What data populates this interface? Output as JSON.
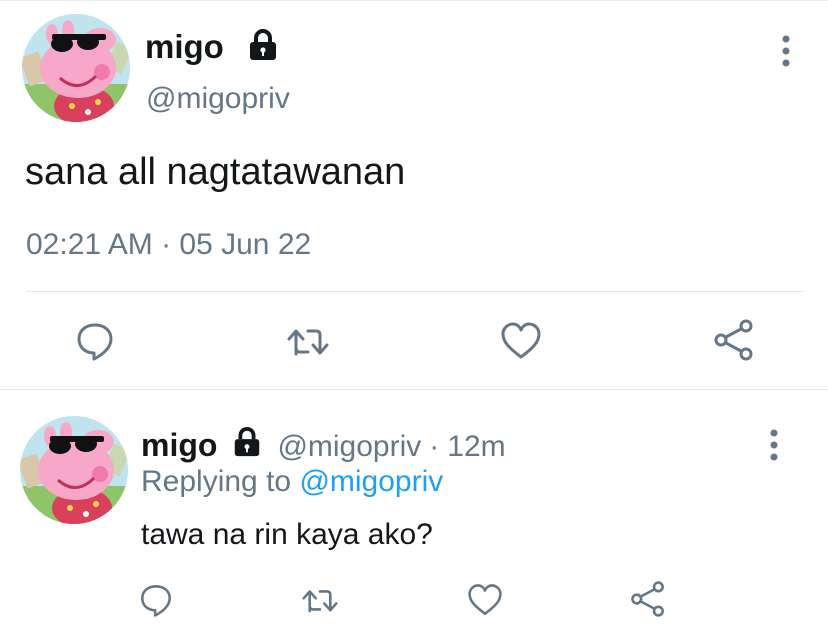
{
  "main_tweet": {
    "author_name": "migo",
    "author_handle": "@migopriv",
    "text": "sana all nagtatawanan",
    "timestamp": "02:21 AM · 05 Jun 22",
    "icons": {
      "lock": "lock-icon",
      "more": "more-vertical-icon",
      "reply": "reply-icon",
      "retweet": "retweet-icon",
      "like": "heart-icon",
      "share": "share-icon"
    }
  },
  "reply_tweet": {
    "author_name": "migo",
    "author_handle": "@migopriv",
    "dot": "·",
    "time_ago": "12m",
    "replying_prefix": "Replying to",
    "replying_mention": "@migopriv",
    "text": "tawa na rin kaya ako?"
  },
  "colors": {
    "text_primary": "#14171a",
    "text_secondary": "#657786",
    "link": "#1da1f2",
    "icon": "#657786",
    "divider": "#e1e8ed"
  }
}
